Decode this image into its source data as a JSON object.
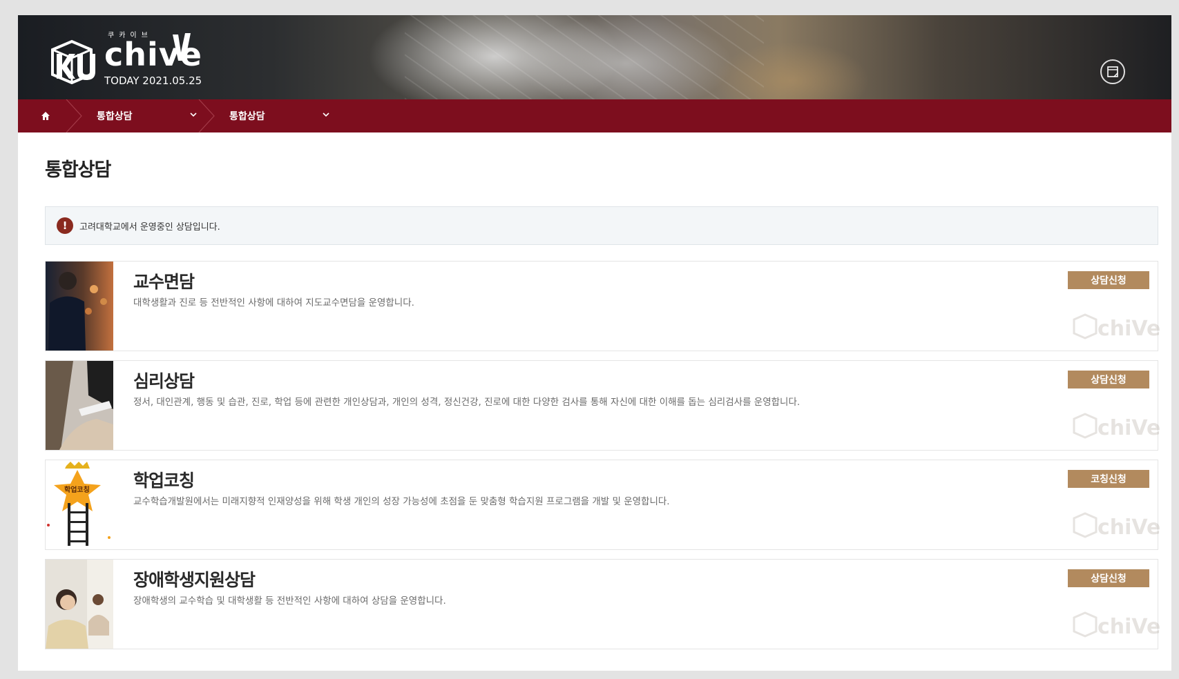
{
  "header": {
    "logo_sub": "쿠카이브",
    "logo_word": "chive",
    "logo_word_rest": "e",
    "today": "TODAY 2021.05.25",
    "icon": "memo-icon"
  },
  "nav": {
    "home_icon": "home-icon",
    "crumbs": [
      {
        "label": "통합상담"
      },
      {
        "label": "통합상담"
      }
    ]
  },
  "page": {
    "title": "통합상담",
    "notice": "고려대학교에서 운영중인 상담입니다."
  },
  "cards": [
    {
      "title": "교수면담",
      "desc": "대학생활과 진로 등 전반적인 사항에 대하여 지도교수면담을 운영합니다.",
      "button": "상담신청"
    },
    {
      "title": "심리상담",
      "desc": "정서, 대인관계, 행동 및 습관, 진로, 학업 등에 관련한 개인상담과, 개인의 성격, 정신건강, 진로에 대한 다양한 검사를 통해 자신에 대한 이해를 돕는 심리검사를 운영합니다.",
      "button": "상담신청"
    },
    {
      "title": "학업코칭",
      "desc": "교수학습개발원에서는 미래지향적 인재양성을 위해 학생 개인의 성장 가능성에 초점을 둔 맞춤형 학습지원 프로그램을 개발 및 운영합니다.",
      "button": "코칭신청",
      "thumb_text": "학업코칭"
    },
    {
      "title": "장애학생지원상담",
      "desc": "장애학생의 교수학습 및 대학생활 등 전반적인 사항에 대하여 상담을 운영합니다.",
      "button": "상담신청"
    }
  ],
  "colors": {
    "nav_bg": "#7d0e1e",
    "button_bg": "#b28a5e",
    "notice_icon": "#8a2a1f"
  }
}
